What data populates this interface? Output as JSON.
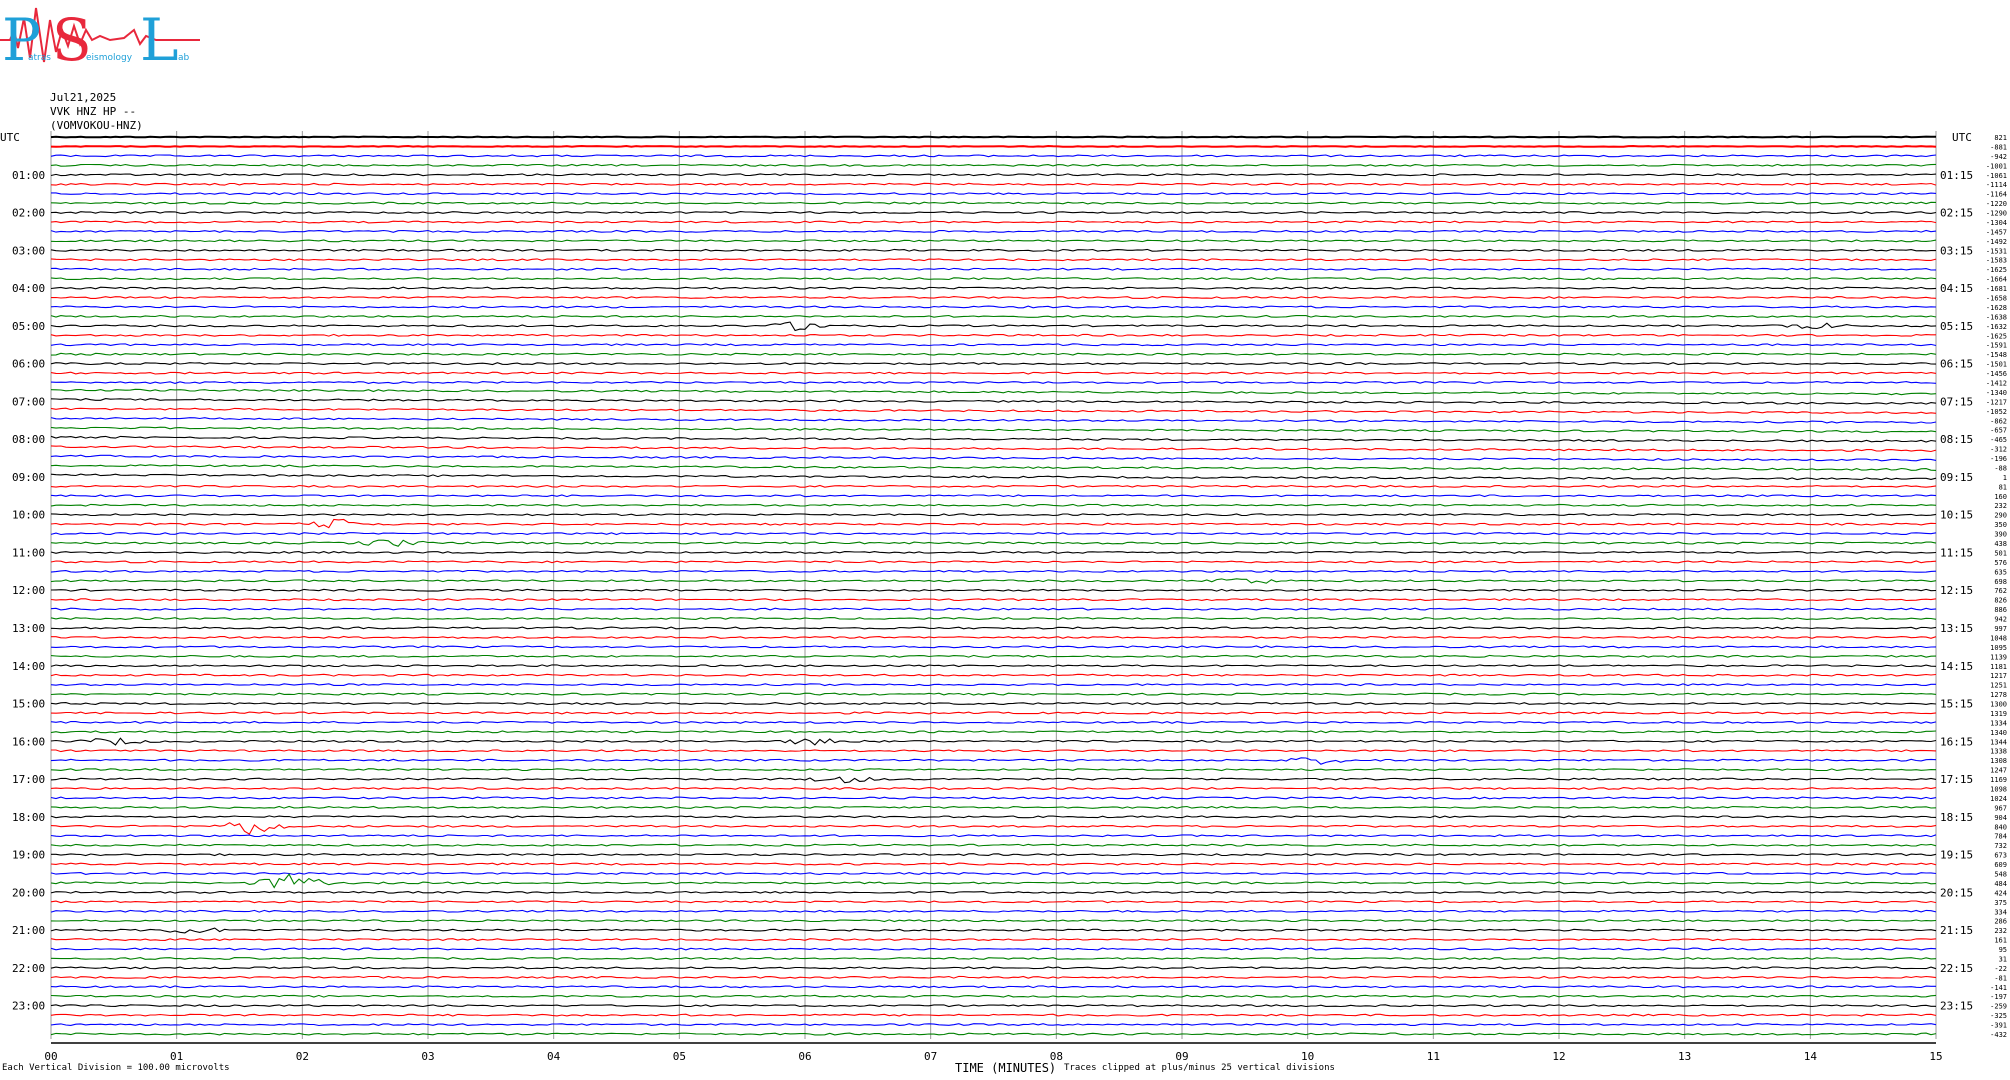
{
  "header": {
    "date": "Jul21,2025",
    "station": "VVK HNZ HP --",
    "channel": "(VOMVOKOU-HNZ)"
  },
  "logo": {
    "letters": "PSL",
    "caption": "Patras Seismology Lab",
    "words": [
      "atras",
      "eismology",
      "ab"
    ]
  },
  "axis": {
    "left_top_label": "UTC",
    "right_top_label": "UTC",
    "xlabel": "TIME (MINUTES)"
  },
  "footer": {
    "left_note": "Each Vertical Division =  100.00 microvolts",
    "clip_note": "Traces clipped at plus/minus 25 vertical divisions"
  },
  "colors": {
    "trace_cycle": [
      "#000000",
      "#ff0000",
      "#0000ff",
      "#008000"
    ],
    "grid": "#9a9a9a",
    "logo_blue": "#1fa0d8",
    "logo_red": "#e8283c"
  },
  "chart_data": {
    "type": "line",
    "title": "Jul21,2025",
    "xlabel": "TIME (MINUTES)",
    "ylabel": "UTC",
    "x_ticks": [
      "00",
      "01",
      "02",
      "03",
      "04",
      "05",
      "06",
      "07",
      "08",
      "09",
      "10",
      "11",
      "12",
      "13",
      "14",
      "15"
    ],
    "xlim": [
      0,
      15
    ],
    "minutes_per_line": 15,
    "line_count": 96,
    "left_hour_labels": [
      "UTC",
      "01:00",
      "02:00",
      "03:00",
      "04:00",
      "05:00",
      "06:00",
      "07:00",
      "08:00",
      "09:00",
      "10:00",
      "11:00",
      "12:00",
      "13:00",
      "14:00",
      "15:00",
      "16:00",
      "17:00",
      "18:00",
      "19:00",
      "20:00",
      "21:00",
      "22:00",
      "23:00"
    ],
    "right_hour_labels": [
      "UTC",
      "01:15",
      "02:15",
      "03:15",
      "04:15",
      "05:15",
      "06:15",
      "07:15",
      "08:15",
      "09:15",
      "10:15",
      "11:15",
      "12:15",
      "13:15",
      "14:15",
      "15:15",
      "16:15",
      "17:15",
      "18:15",
      "19:15",
      "20:15",
      "21:15",
      "22:15",
      "23:15"
    ],
    "right_offsets": [
      821,
      -881,
      -942,
      -1001,
      -1061,
      -1114,
      -1164,
      -1220,
      -1290,
      -1304,
      -1457,
      -1492,
      -1531,
      -1583,
      -1625,
      -1664,
      -1681,
      -1658,
      -1628,
      -1638,
      -1632,
      -1625,
      -1591,
      -1548,
      -1501,
      -1456,
      -1412,
      -1340,
      -1217,
      -1052,
      -862,
      -657,
      -465,
      -312,
      -196,
      -88,
      1,
      81,
      160,
      232,
      290,
      350,
      390,
      438,
      501,
      576,
      635,
      698,
      762,
      826,
      886,
      942,
      997,
      1048,
      1095,
      1139,
      1181,
      1217,
      1251,
      1278,
      1300,
      1319,
      1334,
      1340,
      1344,
      1338,
      1308,
      1247,
      1169,
      1098,
      1024,
      967,
      904,
      840,
      784,
      732,
      673,
      609,
      548,
      484,
      424,
      375,
      334,
      286,
      232,
      161,
      95,
      31,
      -22,
      -81,
      -141,
      -197,
      -259,
      -325,
      -391,
      -432
    ],
    "grid": true,
    "events": [
      {
        "line": 20,
        "minute": 6.0,
        "amplitude": 3
      },
      {
        "line": 20,
        "minute": 14.0,
        "amplitude": 2
      },
      {
        "line": 41,
        "minute": 2.3,
        "amplitude": 3
      },
      {
        "line": 43,
        "minute": 2.7,
        "amplitude": 2
      },
      {
        "line": 47,
        "minute": 9.5,
        "amplitude": 2
      },
      {
        "line": 64,
        "minute": 0.5,
        "amplitude": 2
      },
      {
        "line": 64,
        "minute": 6.1,
        "amplitude": 2
      },
      {
        "line": 66,
        "minute": 10.1,
        "amplitude": 2
      },
      {
        "line": 68,
        "minute": 6.3,
        "amplitude": 2
      },
      {
        "line": 73,
        "minute": 1.6,
        "amplitude": 5
      },
      {
        "line": 79,
        "minute": 1.9,
        "amplitude": 5
      },
      {
        "line": 84,
        "minute": 1.1,
        "amplitude": 2
      }
    ]
  }
}
